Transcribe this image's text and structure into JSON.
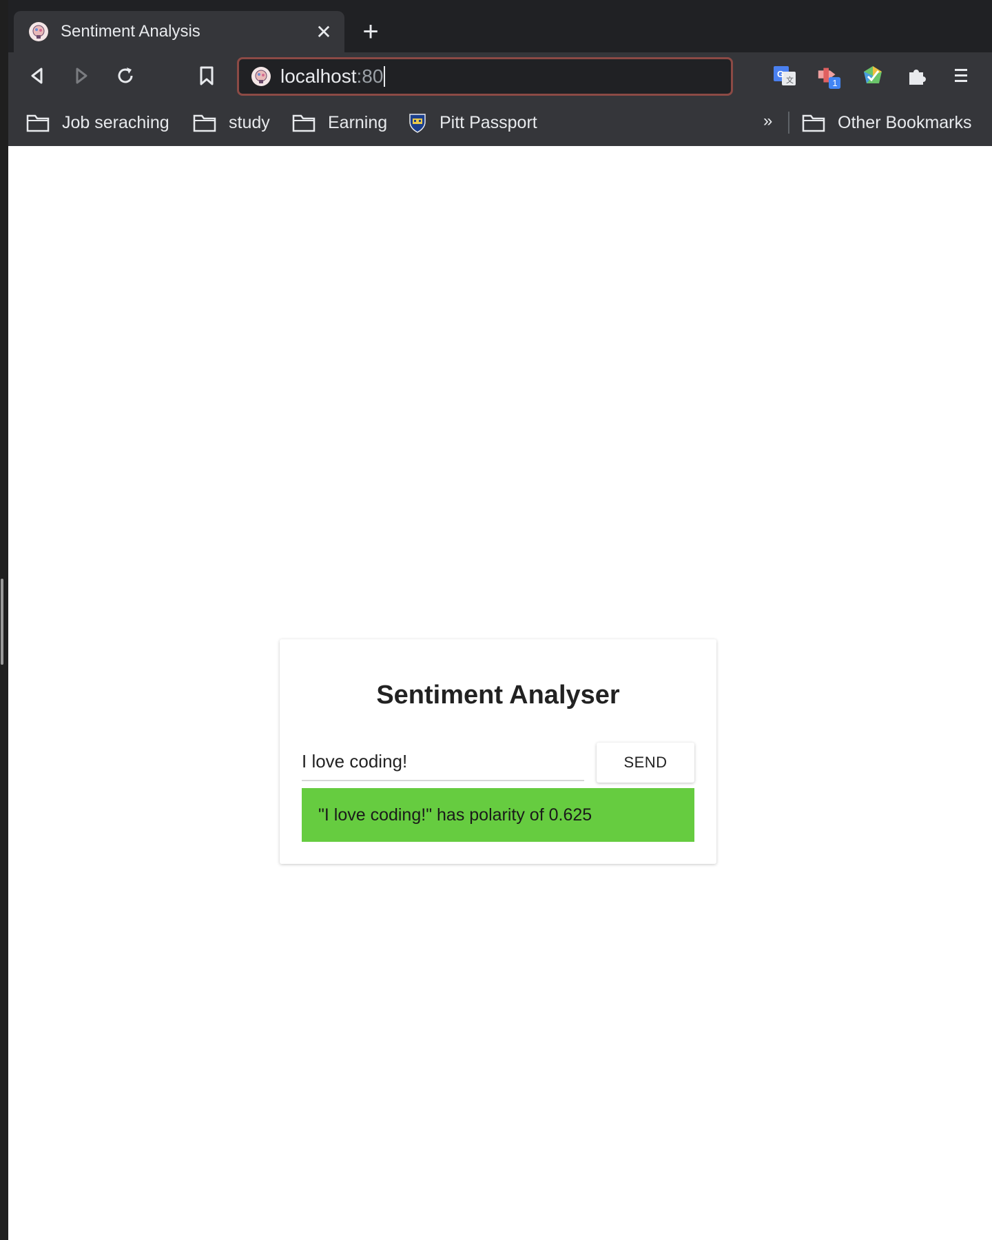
{
  "browser": {
    "tab": {
      "title": "Sentiment Analysis",
      "favicon": "brain-head-icon",
      "close_glyph": "✕"
    },
    "new_tab_glyph": "+",
    "toolbar": {
      "back": "back-icon",
      "forward": "forward-icon",
      "reload": "reload-icon",
      "bookmark": "bookmark-icon",
      "address": {
        "host": "localhost",
        "port": ":80"
      },
      "extensions": [
        "google-translate-icon",
        "extension-badge-icon",
        "color-picker-icon",
        "puzzle-icon",
        "menu-icon"
      ],
      "extension_badge_count": "1"
    },
    "bookmarks": {
      "items": [
        {
          "label": "Job seraching",
          "icon": "folder-icon"
        },
        {
          "label": "study",
          "icon": "folder-icon"
        },
        {
          "label": "Earning",
          "icon": "folder-icon"
        },
        {
          "label": "Pitt Passport",
          "icon": "pitt-shield-icon"
        }
      ],
      "overflow_glyph": "»",
      "other": {
        "label": "Other Bookmarks",
        "icon": "folder-icon"
      }
    }
  },
  "app": {
    "title": "Sentiment Analyser",
    "input_value": "I love coding!",
    "send_label": "SEND",
    "result_text": "\"I love coding!\" has polarity of 0.625",
    "result_color": "#66cc40"
  },
  "colors": {
    "tabstrip": "#202124",
    "toolbar": "#35363a",
    "omnibox_border": "#8c4a45",
    "badge": "#4285f4"
  }
}
